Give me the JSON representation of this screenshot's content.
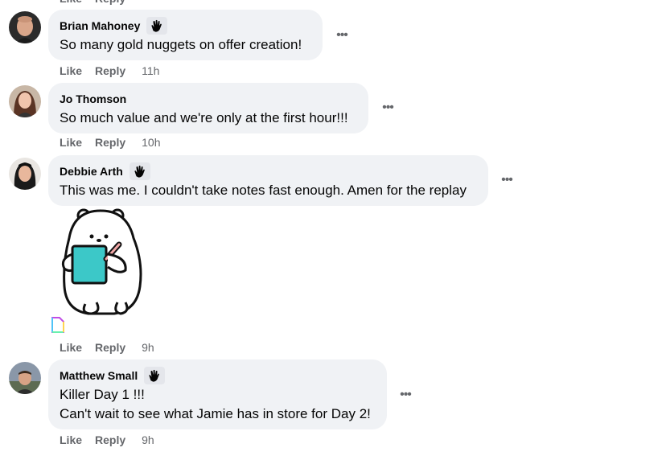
{
  "comments": [
    {
      "author": "Brian Mahoney",
      "lines": [
        "So many gold nuggets on offer creation!"
      ],
      "like_label": "Like",
      "reply_label": "Reply",
      "time": "11h"
    },
    {
      "author": "Jo Thomson",
      "lines": [
        "So much value and we're only at the first hour!!!"
      ],
      "like_label": "Like",
      "reply_label": "Reply",
      "time": "10h"
    },
    {
      "author": "Debbie Arth",
      "lines": [
        "This was me. I couldn't take notes fast enough. Amen for the replay"
      ],
      "like_label": "Like",
      "reply_label": "Reply",
      "time": "9h"
    },
    {
      "author": "Matthew Small",
      "lines": [
        "Killer Day 1 !!!",
        "Can't wait to see what Jamie has in store for Day 2!"
      ],
      "like_label": "Like",
      "reply_label": "Reply",
      "time": "9h"
    }
  ],
  "more_options_glyph": "•••",
  "icons": {
    "badge": "waving-hand-icon",
    "more": "more-options-icon",
    "sticker": "polar-bear-notepad-sticker",
    "gif": "gif-attachment-icon"
  },
  "colors": {
    "bubble": "#f0f2f5",
    "secondary_text": "#65676b",
    "badge_bg": "#e4e6eb",
    "notepad": "#3cc8c8"
  }
}
